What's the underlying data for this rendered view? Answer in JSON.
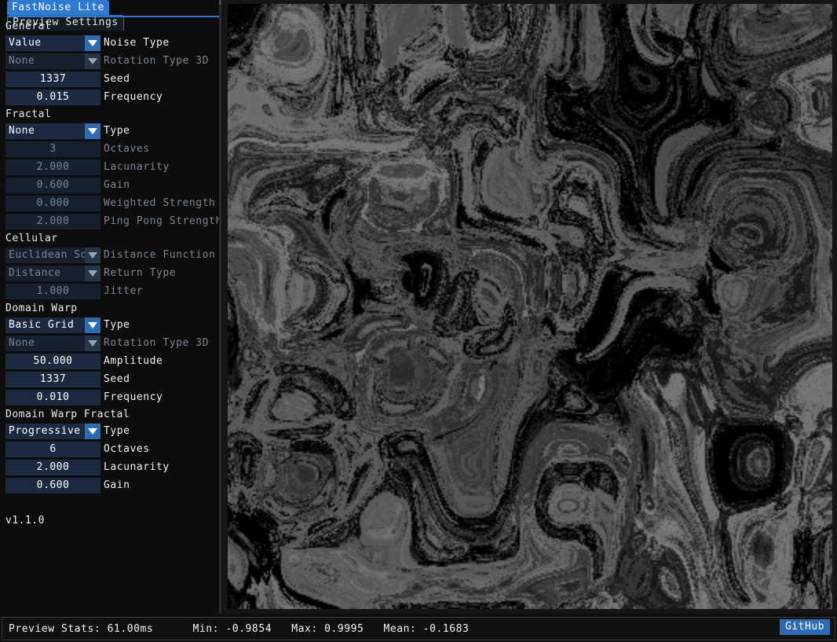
{
  "app": {
    "version_label": "v1.1.0"
  },
  "tabs": [
    {
      "label": "FastNoise Lite",
      "active": true
    },
    {
      "label": "Preview Settings",
      "active": false
    }
  ],
  "sections": [
    {
      "header": "General",
      "rows": [
        {
          "type": "combo",
          "value": "Value",
          "label": "Noise Type",
          "enabled": true
        },
        {
          "type": "combo",
          "value": "None",
          "label": "Rotation Type 3D",
          "enabled": false
        },
        {
          "type": "number",
          "value": "1337",
          "label": "Seed",
          "enabled": true
        },
        {
          "type": "number",
          "value": "0.015",
          "label": "Frequency",
          "enabled": true
        }
      ]
    },
    {
      "header": "Fractal",
      "rows": [
        {
          "type": "combo",
          "value": "None",
          "label": "Type",
          "enabled": true
        },
        {
          "type": "number",
          "value": "3",
          "label": "Octaves",
          "enabled": false
        },
        {
          "type": "number",
          "value": "2.000",
          "label": "Lacunarity",
          "enabled": false
        },
        {
          "type": "number",
          "value": "0.600",
          "label": "Gain",
          "enabled": false
        },
        {
          "type": "number",
          "value": "0.000",
          "label": "Weighted Strength",
          "enabled": false
        },
        {
          "type": "number",
          "value": "2.000",
          "label": "Ping Pong Strength",
          "enabled": false
        }
      ]
    },
    {
      "header": "Cellular",
      "rows": [
        {
          "type": "combo",
          "value": "Euclidean Sq",
          "label": "Distance Function",
          "enabled": false
        },
        {
          "type": "combo",
          "value": "Distance",
          "label": "Return Type",
          "enabled": false
        },
        {
          "type": "number",
          "value": "1.000",
          "label": "Jitter",
          "enabled": false
        }
      ]
    },
    {
      "header": "Domain Warp",
      "rows": [
        {
          "type": "combo",
          "value": "Basic Grid",
          "label": "Type",
          "enabled": true
        },
        {
          "type": "combo",
          "value": "None",
          "label": "Rotation Type 3D",
          "enabled": false
        },
        {
          "type": "number",
          "value": "50.000",
          "label": "Amplitude",
          "enabled": true
        },
        {
          "type": "number",
          "value": "1337",
          "label": "Seed",
          "enabled": true
        },
        {
          "type": "number",
          "value": "0.010",
          "label": "Frequency",
          "enabled": true
        }
      ]
    },
    {
      "header": "Domain Warp Fractal",
      "rows": [
        {
          "type": "combo",
          "value": "Progressive",
          "label": "Type",
          "enabled": true
        },
        {
          "type": "number",
          "value": "6",
          "label": "Octaves",
          "enabled": true
        },
        {
          "type": "number",
          "value": "2.000",
          "label": "Lacunarity",
          "enabled": true
        },
        {
          "type": "number",
          "value": "0.600",
          "label": "Gain",
          "enabled": true
        }
      ]
    }
  ],
  "status": {
    "text": "Preview Stats: 61.00ms      Min: -0.9854   Max: 0.9995   Mean: -0.1683",
    "preview_stats_label": "Preview Stats:",
    "preview_time": "61.00ms",
    "min_label": "Min:",
    "min_value": "-0.9854",
    "max_label": "Max:",
    "max_value": "0.9995",
    "mean_label": "Mean:",
    "mean_value": "-0.1683",
    "github_label": "GitHub"
  },
  "colors": {
    "accent": "#2e7ad1",
    "field_bg": "#1b2a40",
    "field_bg_disabled": "#16202e",
    "panel_bg": "#0d0d0d",
    "text": "#f0f2f4",
    "text_disabled": "#7b8694"
  },
  "preview": {
    "noise_type": "value",
    "description": "grayscale domain-warped value noise preview"
  }
}
